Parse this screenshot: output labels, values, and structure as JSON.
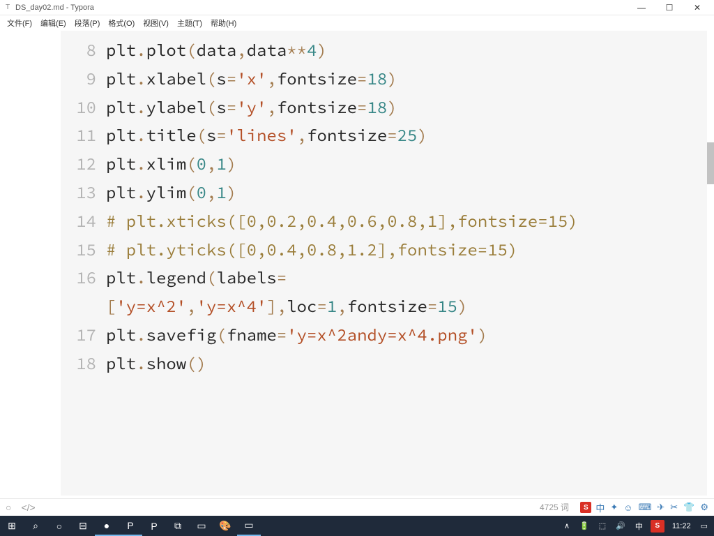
{
  "titlebar": {
    "icon_label": "T",
    "title": "DS_day02.md - Typora"
  },
  "window_buttons": {
    "min": "—",
    "max": "☐",
    "close": "✕"
  },
  "menubar": {
    "file": "文件(F)",
    "edit": "编辑(E)",
    "paragraph": "段落(P)",
    "format": "格式(O)",
    "view": "视图(V)",
    "theme": "主题(T)",
    "help": "帮助(H)"
  },
  "code": {
    "ln8_num": "8",
    "ln8_a": "plt",
    "ln8_b": ".",
    "ln8_c": "plot",
    "ln8_d": "(",
    "ln8_e": "data",
    "ln8_f": ",",
    "ln8_g": "data",
    "ln8_h": "**",
    "ln8_i": "4",
    "ln8_j": ")",
    "ln9_num": "9",
    "ln9_a": "plt",
    "ln9_b": ".",
    "ln9_c": "xlabel",
    "ln9_d": "(",
    "ln9_e": "s",
    "ln9_f": "=",
    "ln9_g": "'x'",
    "ln9_h": ",",
    "ln9_i": "fontsize",
    "ln9_j": "=",
    "ln9_k": "18",
    "ln9_l": ")",
    "ln10_num": "10",
    "ln10_a": "plt",
    "ln10_b": ".",
    "ln10_c": "ylabel",
    "ln10_d": "(",
    "ln10_e": "s",
    "ln10_f": "=",
    "ln10_g": "'y'",
    "ln10_h": ",",
    "ln10_i": "fontsize",
    "ln10_j": "=",
    "ln10_k": "18",
    "ln10_l": ")",
    "ln11_num": "11",
    "ln11_a": "plt",
    "ln11_b": ".",
    "ln11_c": "title",
    "ln11_d": "(",
    "ln11_e": "s",
    "ln11_f": "=",
    "ln11_g": "'lines'",
    "ln11_h": ",",
    "ln11_i": "fontsize",
    "ln11_j": "=",
    "ln11_k": "25",
    "ln11_l": ")",
    "ln12_num": "12",
    "ln12_a": "plt",
    "ln12_b": ".",
    "ln12_c": "xlim",
    "ln12_d": "(",
    "ln12_e": "0",
    "ln12_f": ",",
    "ln12_g": "1",
    "ln12_h": ")",
    "ln13_num": "13",
    "ln13_a": "plt",
    "ln13_b": ".",
    "ln13_c": "ylim",
    "ln13_d": "(",
    "ln13_e": "0",
    "ln13_f": ",",
    "ln13_g": "1",
    "ln13_h": ")",
    "ln14_num": "14",
    "ln14_a": "# plt.xticks([0,0.2,0.4,0.6,0.8,1],fontsize=15)",
    "ln15_num": "15",
    "ln15_a": "# plt.yticks([0,0.4,0.8,1.2],fontsize=15)",
    "ln16_num": "16",
    "ln16_a": "plt",
    "ln16_b": ".",
    "ln16_c": "legend",
    "ln16_d": "(",
    "ln16_e": "labels",
    "ln16_f1": "=",
    "ln16_f": "[",
    "ln16_g": "'y=x^2'",
    "ln16_h": ",",
    "ln16_i": "'y=x^4'",
    "ln16_j": "]",
    "ln16_k": ",",
    "ln16_l": "loc",
    "ln16_m": "=",
    "ln16_n": "1",
    "ln16_o": ",",
    "ln16_p": "fontsize",
    "ln16_q": "=",
    "ln16_r": "15",
    "ln16_s": ")",
    "ln17_num": "17",
    "ln17_a": "plt",
    "ln17_b": ".",
    "ln17_c": "savefig",
    "ln17_d": "(",
    "ln17_e": "fname",
    "ln17_f": "=",
    "ln17_g": "'y=x^2andy=x^4.png'",
    "ln17_h": ")",
    "ln18_num": "18",
    "ln18_a": "plt",
    "ln18_b": ".",
    "ln18_c": "show",
    "ln18_d": "(",
    "ln18_e": ")"
  },
  "ime": {
    "logo": "S",
    "lang": "中",
    "items": [
      "✦",
      "☺",
      "⌨",
      "✈",
      "✂",
      "👕",
      "⚙"
    ]
  },
  "statusbar": {
    "outline": "○",
    "source": "</>",
    "words": "4725 词"
  },
  "taskbar": {
    "start": "⊞",
    "search": "⌕",
    "cortana": "○",
    "taskview": "⊟",
    "apps": [
      "●",
      "P",
      "P",
      "⧉",
      "▭",
      "🎨",
      "▭"
    ],
    "tray": {
      "up": "∧",
      "bat": "🔋",
      "net": "⬚",
      "vol": "🔊",
      "ime": "中",
      "sogou": "S",
      "time": "11:22",
      "notif": "▭"
    }
  }
}
